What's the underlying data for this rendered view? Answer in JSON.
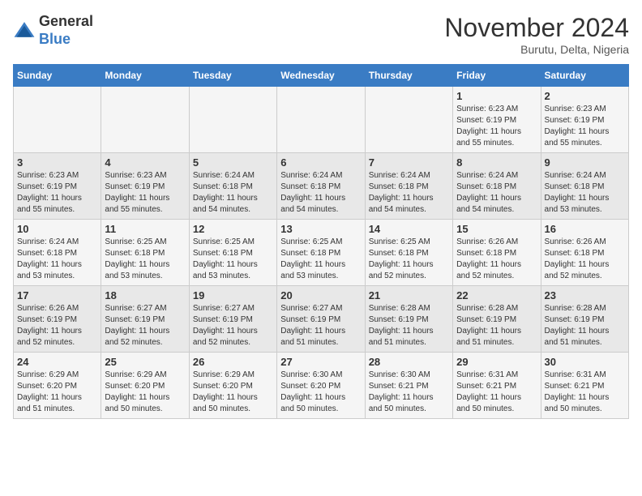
{
  "header": {
    "logo_line1": "General",
    "logo_line2": "Blue",
    "month_year": "November 2024",
    "location": "Burutu, Delta, Nigeria"
  },
  "days_of_week": [
    "Sunday",
    "Monday",
    "Tuesday",
    "Wednesday",
    "Thursday",
    "Friday",
    "Saturday"
  ],
  "weeks": [
    [
      {
        "day": "",
        "info": ""
      },
      {
        "day": "",
        "info": ""
      },
      {
        "day": "",
        "info": ""
      },
      {
        "day": "",
        "info": ""
      },
      {
        "day": "",
        "info": ""
      },
      {
        "day": "1",
        "info": "Sunrise: 6:23 AM\nSunset: 6:19 PM\nDaylight: 11 hours\nand 55 minutes."
      },
      {
        "day": "2",
        "info": "Sunrise: 6:23 AM\nSunset: 6:19 PM\nDaylight: 11 hours\nand 55 minutes."
      }
    ],
    [
      {
        "day": "3",
        "info": "Sunrise: 6:23 AM\nSunset: 6:19 PM\nDaylight: 11 hours\nand 55 minutes."
      },
      {
        "day": "4",
        "info": "Sunrise: 6:23 AM\nSunset: 6:19 PM\nDaylight: 11 hours\nand 55 minutes."
      },
      {
        "day": "5",
        "info": "Sunrise: 6:24 AM\nSunset: 6:18 PM\nDaylight: 11 hours\nand 54 minutes."
      },
      {
        "day": "6",
        "info": "Sunrise: 6:24 AM\nSunset: 6:18 PM\nDaylight: 11 hours\nand 54 minutes."
      },
      {
        "day": "7",
        "info": "Sunrise: 6:24 AM\nSunset: 6:18 PM\nDaylight: 11 hours\nand 54 minutes."
      },
      {
        "day": "8",
        "info": "Sunrise: 6:24 AM\nSunset: 6:18 PM\nDaylight: 11 hours\nand 54 minutes."
      },
      {
        "day": "9",
        "info": "Sunrise: 6:24 AM\nSunset: 6:18 PM\nDaylight: 11 hours\nand 53 minutes."
      }
    ],
    [
      {
        "day": "10",
        "info": "Sunrise: 6:24 AM\nSunset: 6:18 PM\nDaylight: 11 hours\nand 53 minutes."
      },
      {
        "day": "11",
        "info": "Sunrise: 6:25 AM\nSunset: 6:18 PM\nDaylight: 11 hours\nand 53 minutes."
      },
      {
        "day": "12",
        "info": "Sunrise: 6:25 AM\nSunset: 6:18 PM\nDaylight: 11 hours\nand 53 minutes."
      },
      {
        "day": "13",
        "info": "Sunrise: 6:25 AM\nSunset: 6:18 PM\nDaylight: 11 hours\nand 53 minutes."
      },
      {
        "day": "14",
        "info": "Sunrise: 6:25 AM\nSunset: 6:18 PM\nDaylight: 11 hours\nand 52 minutes."
      },
      {
        "day": "15",
        "info": "Sunrise: 6:26 AM\nSunset: 6:18 PM\nDaylight: 11 hours\nand 52 minutes."
      },
      {
        "day": "16",
        "info": "Sunrise: 6:26 AM\nSunset: 6:18 PM\nDaylight: 11 hours\nand 52 minutes."
      }
    ],
    [
      {
        "day": "17",
        "info": "Sunrise: 6:26 AM\nSunset: 6:19 PM\nDaylight: 11 hours\nand 52 minutes."
      },
      {
        "day": "18",
        "info": "Sunrise: 6:27 AM\nSunset: 6:19 PM\nDaylight: 11 hours\nand 52 minutes."
      },
      {
        "day": "19",
        "info": "Sunrise: 6:27 AM\nSunset: 6:19 PM\nDaylight: 11 hours\nand 52 minutes."
      },
      {
        "day": "20",
        "info": "Sunrise: 6:27 AM\nSunset: 6:19 PM\nDaylight: 11 hours\nand 51 minutes."
      },
      {
        "day": "21",
        "info": "Sunrise: 6:28 AM\nSunset: 6:19 PM\nDaylight: 11 hours\nand 51 minutes."
      },
      {
        "day": "22",
        "info": "Sunrise: 6:28 AM\nSunset: 6:19 PM\nDaylight: 11 hours\nand 51 minutes."
      },
      {
        "day": "23",
        "info": "Sunrise: 6:28 AM\nSunset: 6:19 PM\nDaylight: 11 hours\nand 51 minutes."
      }
    ],
    [
      {
        "day": "24",
        "info": "Sunrise: 6:29 AM\nSunset: 6:20 PM\nDaylight: 11 hours\nand 51 minutes."
      },
      {
        "day": "25",
        "info": "Sunrise: 6:29 AM\nSunset: 6:20 PM\nDaylight: 11 hours\nand 50 minutes."
      },
      {
        "day": "26",
        "info": "Sunrise: 6:29 AM\nSunset: 6:20 PM\nDaylight: 11 hours\nand 50 minutes."
      },
      {
        "day": "27",
        "info": "Sunrise: 6:30 AM\nSunset: 6:20 PM\nDaylight: 11 hours\nand 50 minutes."
      },
      {
        "day": "28",
        "info": "Sunrise: 6:30 AM\nSunset: 6:21 PM\nDaylight: 11 hours\nand 50 minutes."
      },
      {
        "day": "29",
        "info": "Sunrise: 6:31 AM\nSunset: 6:21 PM\nDaylight: 11 hours\nand 50 minutes."
      },
      {
        "day": "30",
        "info": "Sunrise: 6:31 AM\nSunset: 6:21 PM\nDaylight: 11 hours\nand 50 minutes."
      }
    ]
  ]
}
